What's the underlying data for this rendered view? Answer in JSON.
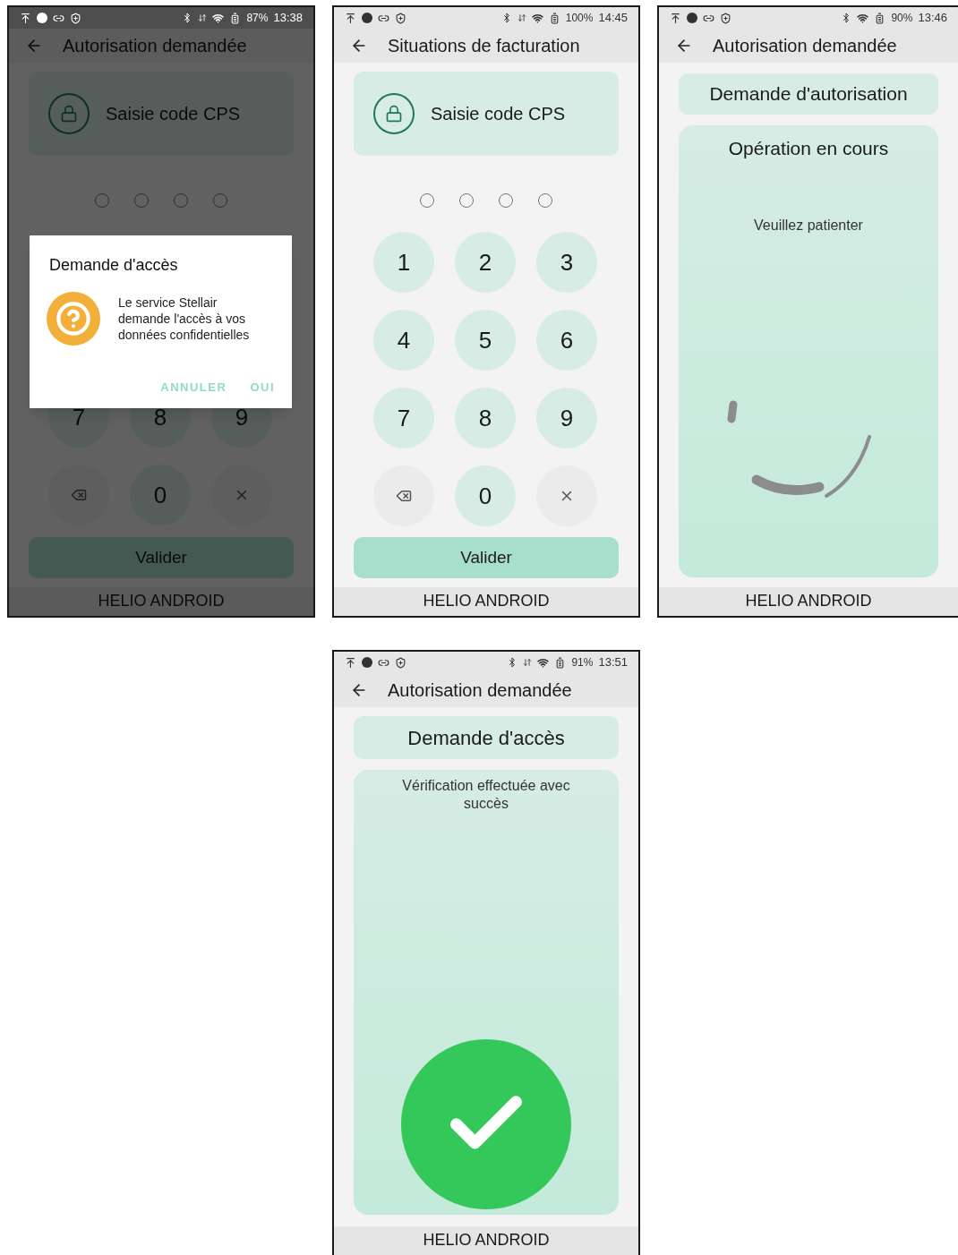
{
  "screens": [
    {
      "kind": "pin",
      "dimmed": true,
      "status_bar": {
        "battery": "87%",
        "time": "13:38",
        "mobile_data": true
      },
      "app_bar": {
        "title": "Autorisation demandée"
      },
      "header_card": {
        "label": "Saisie code CPS"
      },
      "keypad": [
        {
          "kind": "digit",
          "label": "7"
        },
        {
          "kind": "digit",
          "label": "8"
        },
        {
          "kind": "digit",
          "label": "9"
        },
        {
          "kind": "delete"
        },
        {
          "kind": "digit",
          "label": "0"
        },
        {
          "kind": "clear"
        }
      ],
      "submit": "Valider",
      "footer": "HELIO ANDROID",
      "dialog": {
        "title": "Demande d'accès",
        "message": "Le service Stellair demande l'accès à vos données confidentielles",
        "buttons": [
          "ANNULER",
          "OUI"
        ]
      }
    },
    {
      "kind": "pin",
      "dimmed": false,
      "status_bar": {
        "battery": "100%",
        "time": "14:45",
        "mobile_data": true
      },
      "app_bar": {
        "title": "Situations de facturation"
      },
      "header_card": {
        "label": "Saisie code CPS"
      },
      "keypad": [
        {
          "kind": "digit",
          "label": "1"
        },
        {
          "kind": "digit",
          "label": "2"
        },
        {
          "kind": "digit",
          "label": "3"
        },
        {
          "kind": "digit",
          "label": "4"
        },
        {
          "kind": "digit",
          "label": "5"
        },
        {
          "kind": "digit",
          "label": "6"
        },
        {
          "kind": "digit",
          "label": "7"
        },
        {
          "kind": "digit",
          "label": "8"
        },
        {
          "kind": "digit",
          "label": "9"
        },
        {
          "kind": "delete"
        },
        {
          "kind": "digit",
          "label": "0"
        },
        {
          "kind": "clear"
        }
      ],
      "submit": "Valider",
      "footer": "HELIO ANDROID"
    },
    {
      "kind": "progress",
      "dimmed": false,
      "status_bar": {
        "battery": "90%",
        "time": "13:46",
        "mobile_data": false
      },
      "app_bar": {
        "title": "Autorisation demandée"
      },
      "header_card": {
        "label": "Demande d'autorisation"
      },
      "status_title": "Opération en cours",
      "status_message": "Veuillez patienter",
      "footer": "HELIO ANDROID"
    },
    {
      "kind": "success",
      "dimmed": false,
      "status_bar": {
        "battery": "91%",
        "time": "13:51",
        "mobile_data": true
      },
      "app_bar": {
        "title": "Autorisation demandée"
      },
      "header_card": {
        "label": "Demande d'accès"
      },
      "status_message": "Vérification effectuée avec succès",
      "footer": "HELIO ANDROID"
    }
  ]
}
